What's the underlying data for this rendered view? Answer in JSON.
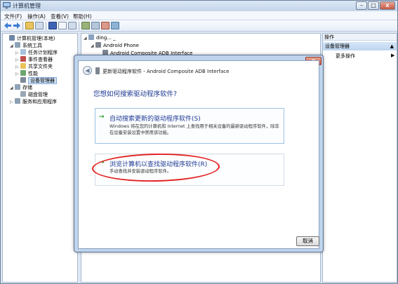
{
  "window": {
    "title": "计算机管理"
  },
  "menu": [
    "文件(F)",
    "操作(A)",
    "查看(V)",
    "帮助(H)"
  ],
  "left_tree": [
    {
      "label": "计算机管理(本地)",
      "indent": 0,
      "expander": "",
      "icon_color": "#6d86a8"
    },
    {
      "label": "系统工具",
      "indent": 1,
      "expander": "◢",
      "icon_color": "#8fa3b8"
    },
    {
      "label": "任务计划程序",
      "indent": 2,
      "expander": "▷",
      "icon_color": "#a7c1df"
    },
    {
      "label": "事件查看器",
      "indent": 2,
      "expander": "▷",
      "icon_color": "#c0504d"
    },
    {
      "label": "共享文件夹",
      "indent": 2,
      "expander": "▷",
      "icon_color": "#e8c35a"
    },
    {
      "label": "性能",
      "indent": 2,
      "expander": "▷",
      "icon_color": "#6da56d"
    },
    {
      "label": "设备管理器",
      "indent": 2,
      "expander": "",
      "icon_color": "#7d8a99",
      "selected": true
    },
    {
      "label": "存储",
      "indent": 1,
      "expander": "◢",
      "icon_color": "#8fa3b8"
    },
    {
      "label": "磁盘管理",
      "indent": 2,
      "expander": "",
      "icon_color": "#9aa7b5"
    },
    {
      "label": "服务和应用程序",
      "indent": 1,
      "expander": "▷",
      "icon_color": "#8da0b3"
    }
  ],
  "middle_tree": [
    {
      "label": "ding... _",
      "indent": 0,
      "expander": "◢"
    },
    {
      "label": "Android Phone",
      "indent": 1,
      "expander": "◢"
    },
    {
      "label": "Android Composite ADB Interface",
      "indent": 2,
      "expander": ""
    }
  ],
  "actions": {
    "header": "操作",
    "section": "设备管理器",
    "section_arrow": "▲",
    "more": "更多操作",
    "more_arrow": "▶"
  },
  "dialog": {
    "back_icon": "back-arrow-icon",
    "title": "更新驱动程序软件 - Android Composite ADB Interface",
    "close_label": "x",
    "question": "您想如何搜索驱动程序软件?",
    "option1": {
      "arrow": "→",
      "heading": "自动搜索更新的驱动程序软件(S)",
      "description": "Windows 将在您的计算机和 Internet 上查找用于相关设备的最新驱动程序软件，除非在设备安装设置中禁用该功能。"
    },
    "option2": {
      "arrow": "→",
      "heading": "浏览计算机以查找驱动程序软件(R)",
      "description": "手动查找并安装驱动程序软件。"
    },
    "cancel_label": "取消"
  },
  "colors": {
    "accent_blue": "#1f3a93",
    "highlight_red": "#e32222",
    "green_arrow": "#2d9a2d"
  }
}
